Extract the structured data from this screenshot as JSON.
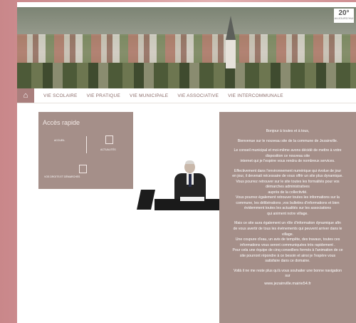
{
  "weather": {
    "temperature": "20°",
    "day": "AUJOURD'HUI"
  },
  "nav": {
    "items": [
      "VIE SCOLAIRE",
      "VIE PRATIQUE",
      "VIE MUNICIPALE",
      "VIE ASSOCIATIVE",
      "VIE INTERCOMMUNALE"
    ]
  },
  "quick_access": {
    "title": "Accès rapide",
    "accueil": "ACCUEIL",
    "actualites": "ACTUALITÉS",
    "droits": "VOS DROITS ET DÉMARCHES"
  },
  "welcome": {
    "greeting": "Bonjour à toutes et à tous,",
    "intro": "Bienvenue sur le nouveau site de la commune de Jezainville.",
    "p1": [
      "Le conseil municipal et moi-même avons décidé de mettre à votre",
      "disposition ce nouveau site",
      "internet qui je l'espère vous rendra de nombreux services."
    ],
    "p2": [
      "Effectivement dans l'environnement numérique qui évolue de jour",
      "en jour, il devenait nécessaire de vous offrir un site plus dynamique.",
      "Vous pourrez retrouver sur le site toutes les formalités pour vos",
      "démarches administratives",
      "auprès de la collectivité.",
      "Vous pourrez également retrouver toutes les informations sur la",
      "commune, les délibérations ,vos bulletins d'informations et bien",
      "évidemment toutes les actualités sur les associations",
      "qui animent notre village."
    ],
    "p3": [
      "Mais ce site aura également un rôle d'information dynamique afin",
      "de vous avertir de tous les événements qui peuvent arriver dans le",
      "village.",
      "Une coupure d'eau, un avis de tempête, des travaux, toutes ces",
      "informations vous seront communiquées très rapidement .",
      "Pour cela une équipe de cinq conseillers formés à l'animation de ce",
      "site pourront répondre à ce besoin et ainsi je l'espère vous",
      "satisfaire dans ce domaine."
    ],
    "p4": [
      "Voilà il ne me reste plus qu'à vous souhaiter une bonne navigation",
      "sur"
    ],
    "site": "www.jezainville.mairie54.fr"
  }
}
